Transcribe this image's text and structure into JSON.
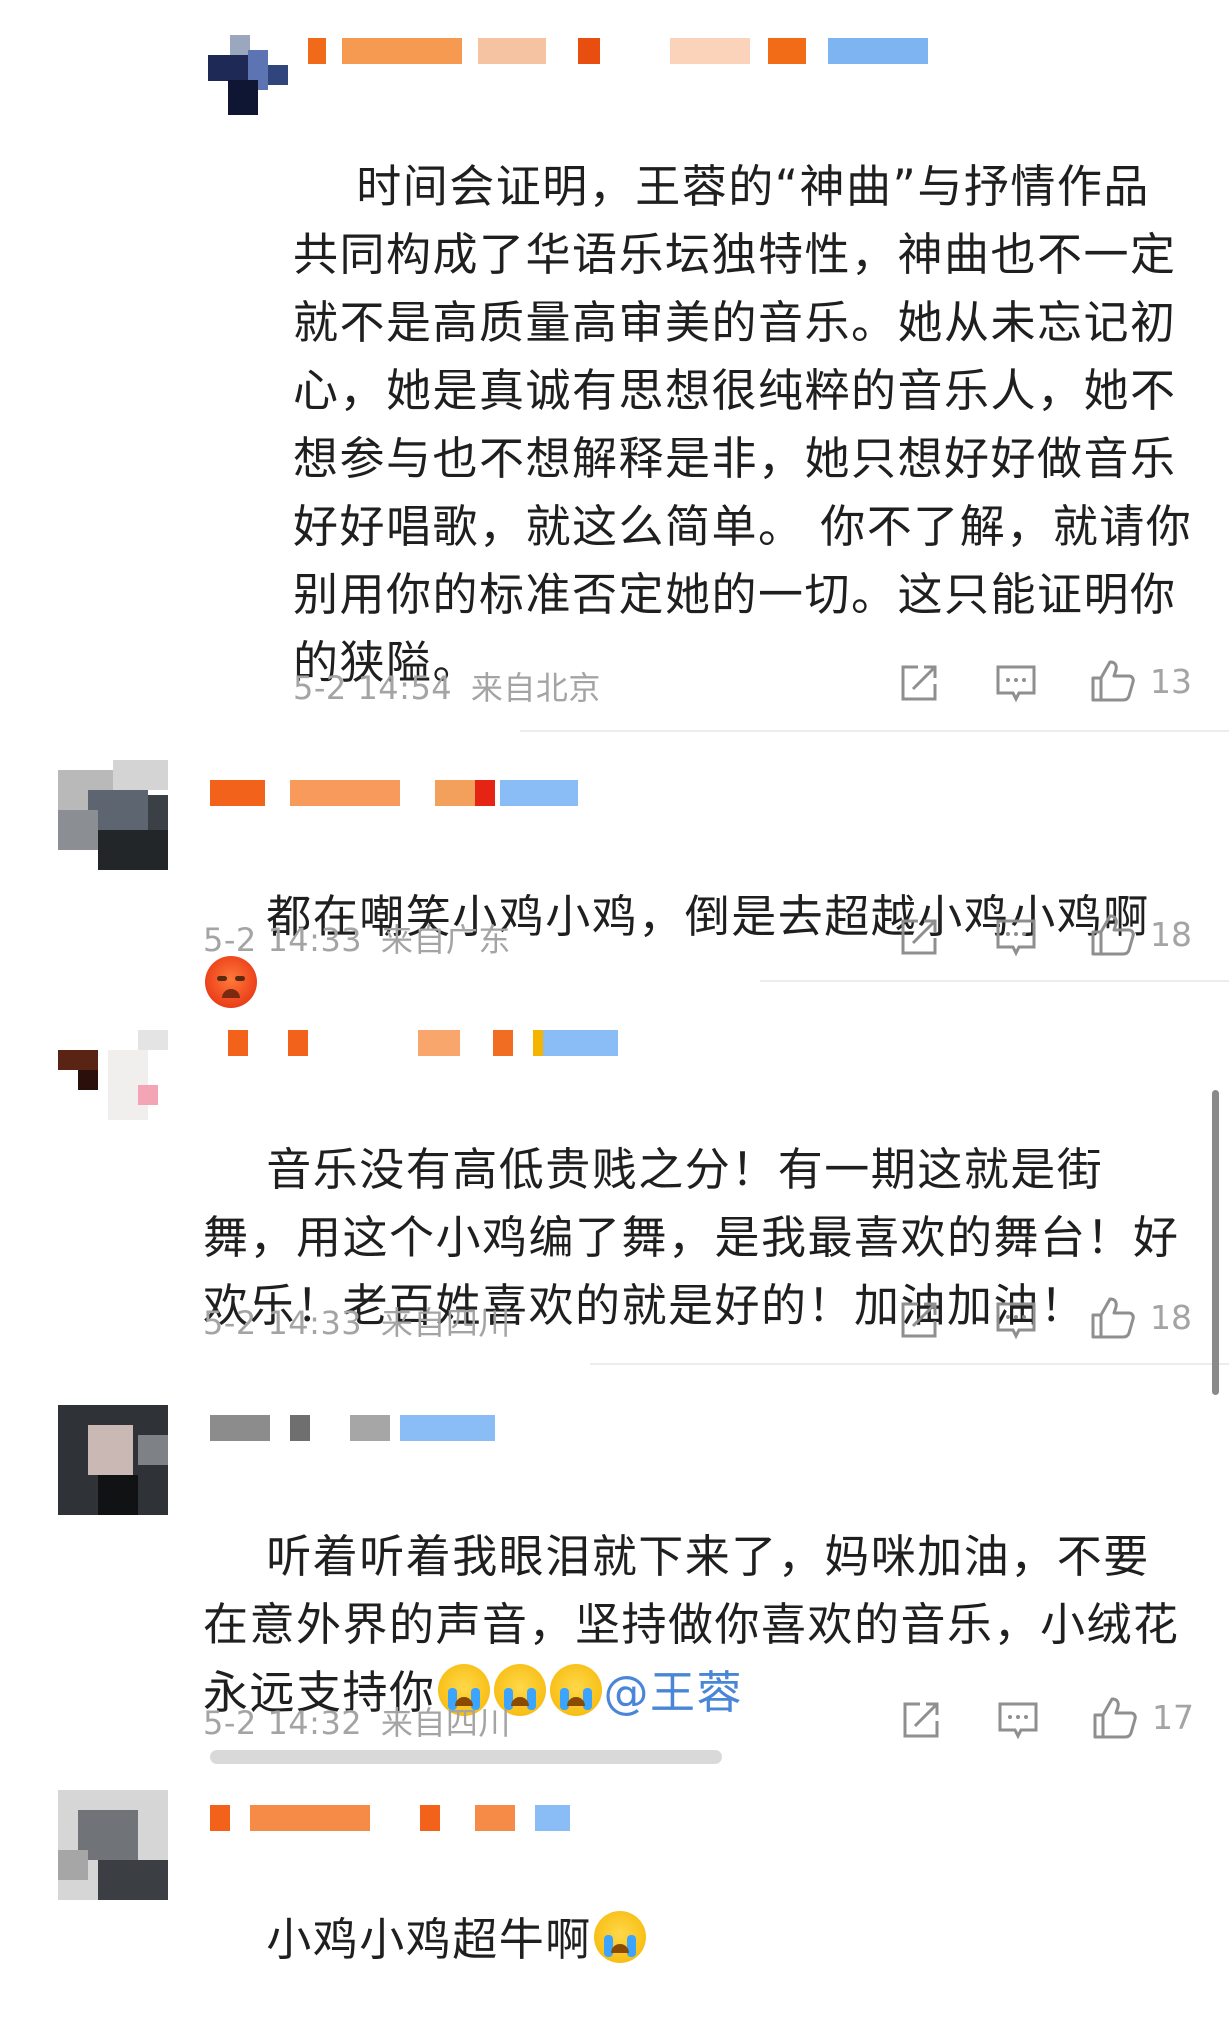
{
  "comments": [
    {
      "text": "时间会证明，王蓉的“神曲”与抒情作品共同构成了华语乐坛独特性，神曲也不一定就不是高质量高审美的音乐。她从未忘记初心，她是真诚有思想很纯粹的音乐人，她不想参与也不想解释是非，她只想好好做音乐好好唱歌，就这么简单。 你不了解，就请你别用你的标准否定她的一切。这只能证明你的狭隘。",
      "time": "5-2 14:54",
      "location": "来自北京",
      "likes": "13"
    },
    {
      "text": "都在嘲笑小鸡小鸡，倒是去超越小鸡小鸡啊",
      "emoji": "angry-emoji",
      "time": "5-2 14:33",
      "location": "来自广东",
      "likes": "18"
    },
    {
      "text": "音乐没有高低贵贱之分！有一期这就是街舞，用这个小鸡编了舞，是我最喜欢的舞台！好欢乐！老百姓喜欢的就是好的！加油加油！",
      "time": "5-2 14:33",
      "location": "来自四川",
      "likes": "18"
    },
    {
      "text": "听着听着我眼泪就下来了，妈咪加油，不要在意外界的声音，坚持做你喜欢的音乐，小绒花永远支持你",
      "emoji": "crying-emoji",
      "mention": "@王蓉",
      "time": "5-2 14:32",
      "location": "来自四川",
      "likes": "17"
    },
    {
      "text": "小鸡小鸡超牛啊",
      "emoji": "crying-emoji"
    }
  ],
  "icons": [
    "share-icon",
    "comment-icon",
    "like-icon"
  ],
  "colors": {
    "meta": "#a4a4a4",
    "mention": "#4a86d8",
    "text": "#1f1f1f"
  }
}
